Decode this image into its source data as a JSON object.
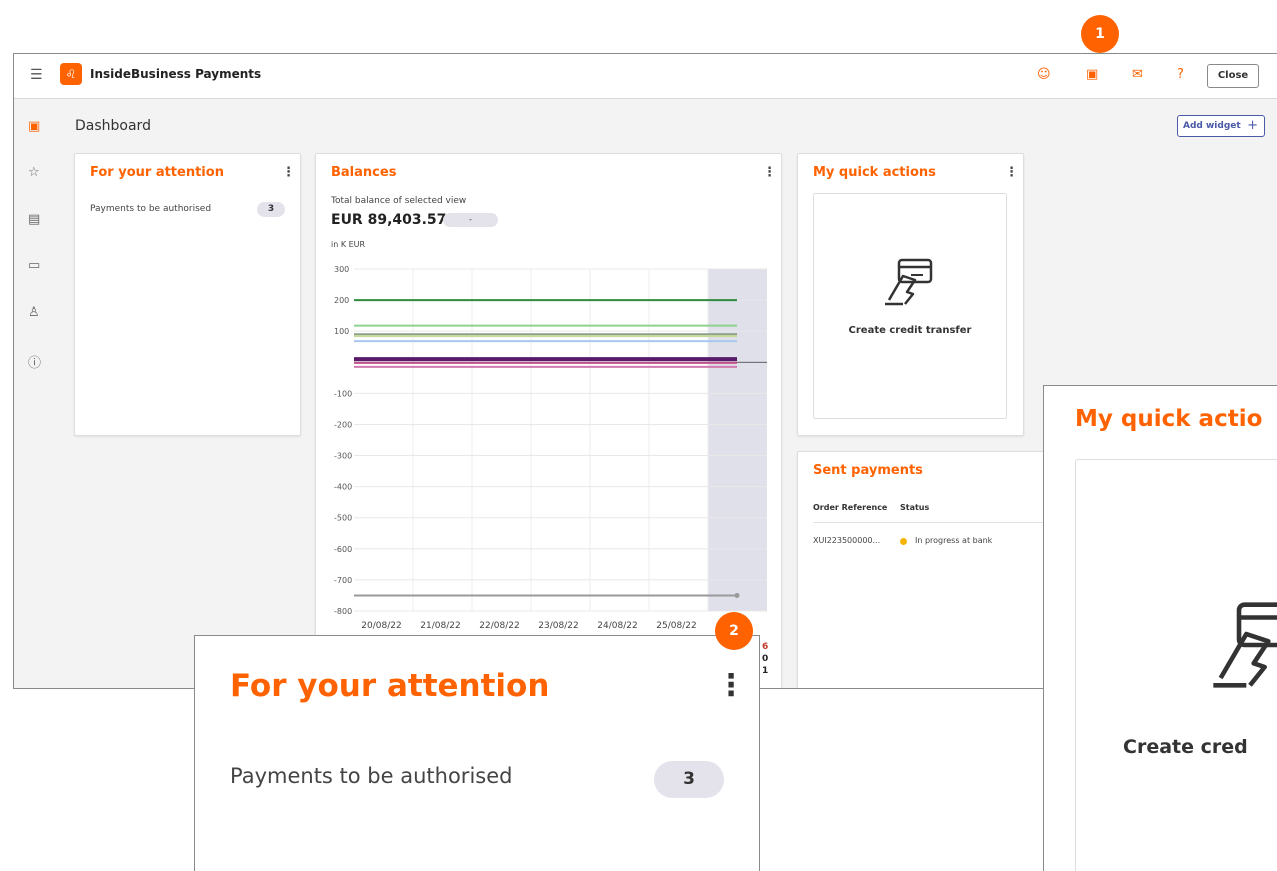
{
  "app": {
    "title": "InsideBusiness Payments",
    "close_label": "Close",
    "page_title": "Dashboard",
    "add_widget_label": "Add widget",
    "add_widget_icon": "+"
  },
  "colors": {
    "accent": "#ff6200",
    "link": "#4a5aa8",
    "pill": "#e4e2ea",
    "chart_highlight": "#dfe0ea"
  },
  "top_icons": [
    "profile-icon",
    "dashboard-icon",
    "mail-icon",
    "help-icon"
  ],
  "sidebar_icons": [
    "dashboard-icon",
    "star-icon",
    "payments-icon",
    "card-icon",
    "user-icon",
    "info-icon"
  ],
  "attention": {
    "title": "For your attention",
    "item_label": "Payments to be authorised",
    "item_count": "3"
  },
  "balances": {
    "title": "Balances",
    "subtitle": "Total balance of selected view",
    "amount": "EUR 89,403.57",
    "pill": "-",
    "unit": "in K EUR",
    "right_fragments": [
      "6",
      "0",
      "1"
    ]
  },
  "chart_data": {
    "type": "line",
    "ylabel": "in K EUR",
    "ylim": [
      -800,
      300
    ],
    "yticks": [
      "300",
      "200",
      "100",
      "-100",
      "-200",
      "-300",
      "-400",
      "-500",
      "-600",
      "-700",
      "-800"
    ],
    "categories": [
      "20/08/22",
      "21/08/22",
      "22/08/22",
      "23/08/22",
      "24/08/22",
      "25/08/22",
      "26/08/22"
    ],
    "series": [
      {
        "color": "#2e8b3e",
        "values": [
          200,
          200,
          200,
          200,
          200,
          200,
          200
        ]
      },
      {
        "color": "#8fd18f",
        "values": [
          118,
          118,
          118,
          118,
          118,
          118,
          118
        ]
      },
      {
        "color": "#8aa08a",
        "values": [
          90,
          90,
          90,
          90,
          90,
          90,
          90
        ]
      },
      {
        "color": "#c6d99a",
        "values": [
          84,
          84,
          84,
          84,
          84,
          84,
          84
        ]
      },
      {
        "color": "#a8c8f0",
        "values": [
          68,
          68,
          68,
          68,
          68,
          68,
          68
        ]
      },
      {
        "color": "#5a1a6a",
        "values": [
          10,
          10,
          10,
          10,
          10,
          10,
          10
        ]
      },
      {
        "color": "#c0508a",
        "values": [
          -2,
          -2,
          -2,
          -2,
          -2,
          -2,
          -2
        ]
      },
      {
        "color": "#d07ab0",
        "values": [
          -15,
          -15,
          -15,
          -15,
          -15,
          -15,
          -15
        ]
      },
      {
        "color": "#999999",
        "values": [
          -750,
          -750,
          -750,
          -750,
          -750,
          -750,
          -750
        ]
      }
    ]
  },
  "quick_actions": {
    "title": "My quick actions",
    "action_label": "Create credit transfer",
    "action_icon": "credit-card-hand-icon"
  },
  "sent_payments": {
    "title": "Sent payments",
    "columns": [
      "Order Reference",
      "Status"
    ],
    "rows": [
      {
        "reference": "XUI223500000...",
        "status": "In progress at bank",
        "status_color": "#f5b400"
      }
    ]
  },
  "zoom_attention": {
    "title": "For your attention",
    "item_label": "Payments to be authorised",
    "item_count": "3"
  },
  "zoom_quick_actions": {
    "title": "My quick actio",
    "action_label": "Create cred"
  },
  "callouts": [
    "1",
    "2"
  ]
}
